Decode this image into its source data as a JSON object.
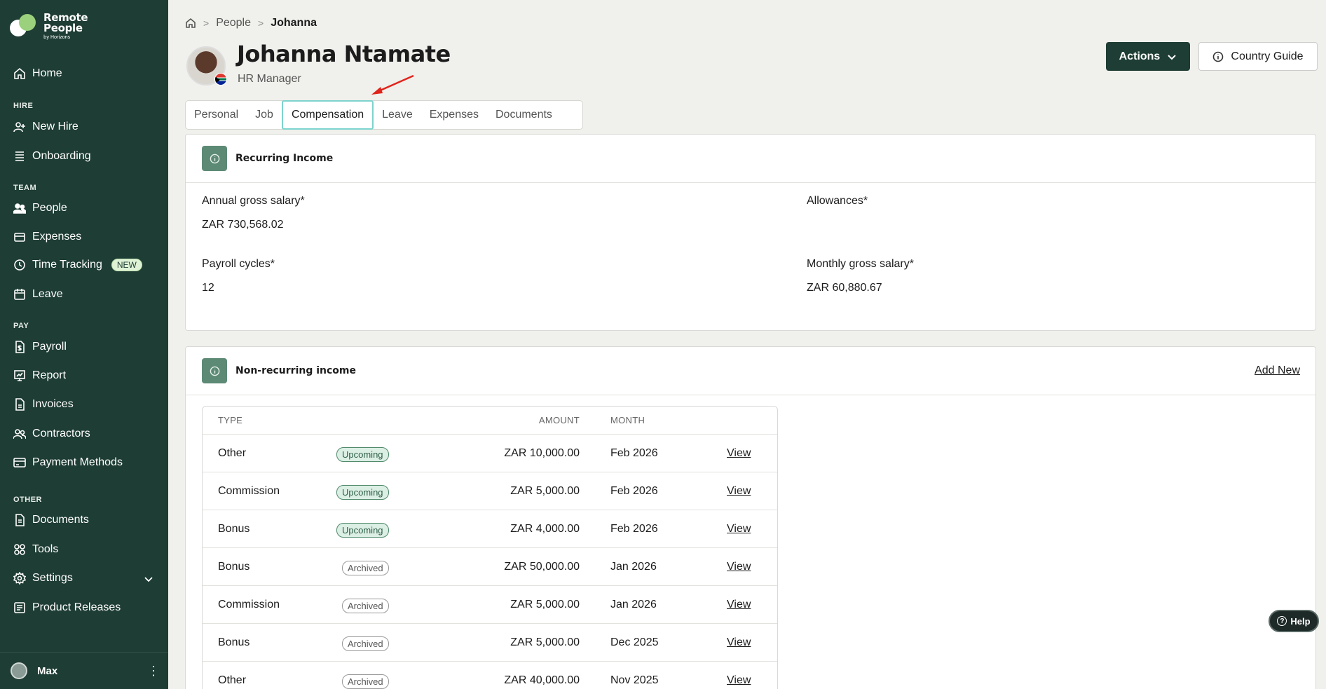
{
  "brand": {
    "name_line1": "Remote",
    "name_line2": "People",
    "tagline": "by Horizons"
  },
  "sidebar": {
    "home": "Home",
    "sections": {
      "hire": "HIRE",
      "team": "TEAM",
      "pay": "PAY",
      "other": "OTHER"
    },
    "items": {
      "new_hire": "New Hire",
      "onboarding": "Onboarding",
      "people": "People",
      "expenses": "Expenses",
      "time_tracking": "Time Tracking",
      "time_tracking_badge": "NEW",
      "leave": "Leave",
      "payroll": "Payroll",
      "report": "Report",
      "invoices": "Invoices",
      "contractors": "Contractors",
      "payment_methods": "Payment Methods",
      "documents": "Documents",
      "tools": "Tools",
      "settings": "Settings",
      "product_releases": "Product Releases"
    },
    "user": {
      "name": "Max"
    }
  },
  "breadcrumb": {
    "people": "People",
    "current": "Johanna"
  },
  "profile": {
    "name": "Johanna Ntamate",
    "title": "HR Manager"
  },
  "header_actions": {
    "actions": "Actions",
    "country_guide": "Country Guide"
  },
  "tabs": {
    "personal": "Personal",
    "job": "Job",
    "compensation": "Compensation",
    "leave": "Leave",
    "expenses": "Expenses",
    "documents": "Documents",
    "active": "Compensation"
  },
  "recurring": {
    "title": "Recurring Income",
    "annual_label": "Annual gross salary*",
    "annual_value": "ZAR 730,568.02",
    "allowances_label": "Allowances*",
    "payroll_label": "Payroll cycles*",
    "payroll_value": "12",
    "monthly_label": "Monthly gross salary*",
    "monthly_value": "ZAR 60,880.67"
  },
  "nonrecurring": {
    "title": "Non-recurring income",
    "add_new": "Add New",
    "columns": {
      "type": "TYPE",
      "amount": "AMOUNT",
      "month": "MONTH"
    },
    "rows": [
      {
        "type": "Other",
        "status": "Upcoming",
        "amount": "ZAR 10,000.00",
        "month": "Feb 2026",
        "action": "View"
      },
      {
        "type": "Commission",
        "status": "Upcoming",
        "amount": "ZAR 5,000.00",
        "month": "Feb 2026",
        "action": "View"
      },
      {
        "type": "Bonus",
        "status": "Upcoming",
        "amount": "ZAR 4,000.00",
        "month": "Feb 2026",
        "action": "View"
      },
      {
        "type": "Bonus",
        "status": "Archived",
        "amount": "ZAR 50,000.00",
        "month": "Jan 2026",
        "action": "View"
      },
      {
        "type": "Commission",
        "status": "Archived",
        "amount": "ZAR 5,000.00",
        "month": "Jan 2026",
        "action": "View"
      },
      {
        "type": "Bonus",
        "status": "Archived",
        "amount": "ZAR 5,000.00",
        "month": "Dec 2025",
        "action": "View"
      },
      {
        "type": "Other",
        "status": "Archived",
        "amount": "ZAR 40,000.00",
        "month": "Nov 2025",
        "action": "View"
      }
    ]
  },
  "help": {
    "label": "Help"
  },
  "colors": {
    "sidebar_bg": "#1e3d34",
    "accent_green": "#5c8a75",
    "active_tab_border": "#7dd4cd",
    "annotation_arrow": "#e0241b"
  }
}
